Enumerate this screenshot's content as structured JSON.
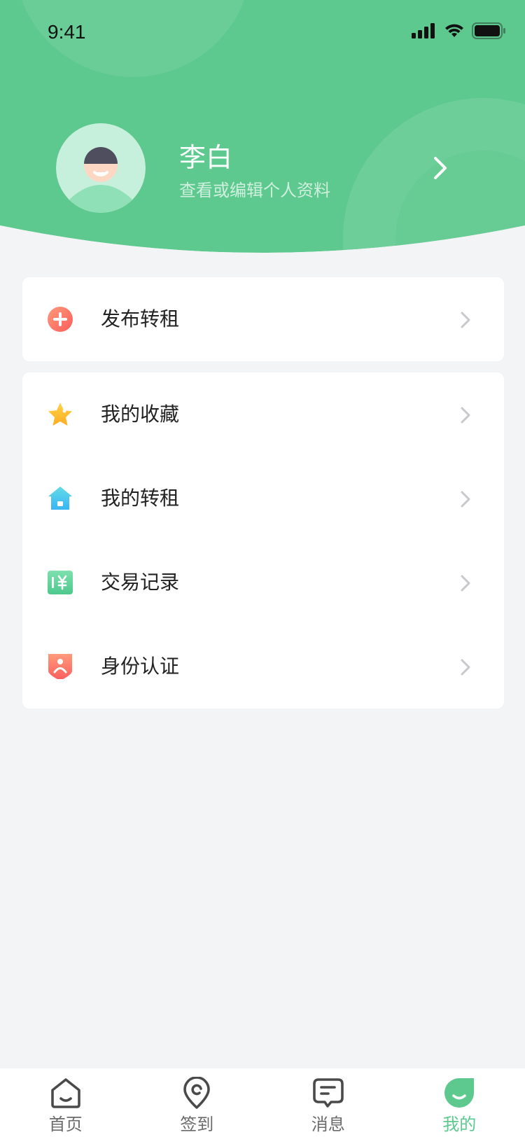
{
  "status_bar": {
    "time": "9:41"
  },
  "colors": {
    "brand_green": "#5ec98f",
    "background": "#f3f4f6",
    "text": "#222222"
  },
  "profile": {
    "name": "李白",
    "subtitle": "查看或编辑个人资料"
  },
  "menu_group_1": [
    {
      "label": "发布转租",
      "icon": "plus-circle-icon"
    }
  ],
  "menu_group_2": [
    {
      "label": "我的收藏",
      "icon": "star-icon"
    },
    {
      "label": "我的转租",
      "icon": "house-icon"
    },
    {
      "label": "交易记录",
      "icon": "yen-receipt-icon"
    },
    {
      "label": "身份认证",
      "icon": "shield-person-icon"
    }
  ],
  "tabbar": [
    {
      "label": "首页",
      "icon": "home-icon",
      "active": false
    },
    {
      "label": "签到",
      "icon": "location-pin-icon",
      "active": false
    },
    {
      "label": "消息",
      "icon": "message-icon",
      "active": false
    },
    {
      "label": "我的",
      "icon": "profile-leaf-icon",
      "active": true
    }
  ]
}
